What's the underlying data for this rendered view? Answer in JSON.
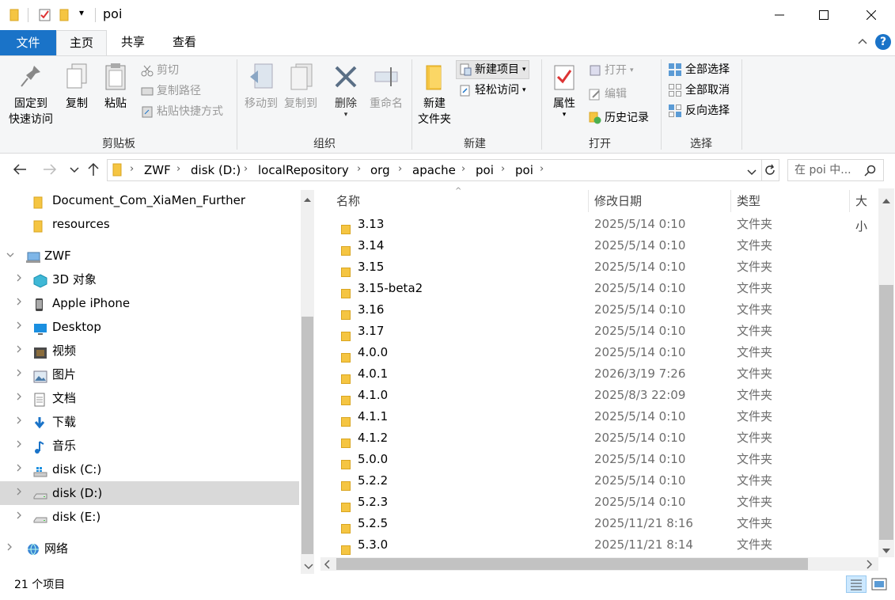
{
  "window": {
    "title": "poi",
    "qa_dropdown": "▾",
    "minimize": "—",
    "maximize": "☐",
    "close": "✕"
  },
  "tabs": [
    {
      "label": "文件"
    },
    {
      "label": "主页"
    },
    {
      "label": "共享"
    },
    {
      "label": "查看"
    }
  ],
  "ribbon": {
    "pin_line1": "固定到",
    "pin_line2": "快速访问",
    "copy": "复制",
    "paste": "粘贴",
    "cut": "剪切",
    "copy_path": "复制路径",
    "paste_shortcut": "粘贴快捷方式",
    "group_clipboard": "剪贴板",
    "move_to": "移动到",
    "copy_to": "复制到",
    "delete": "删除",
    "rename": "重命名",
    "group_organize": "组织",
    "new_folder_line1": "新建",
    "new_folder_line2": "文件夹",
    "new_item": "新建项目",
    "easy_access": "轻松访问",
    "group_new": "新建",
    "properties": "属性",
    "open": "打开",
    "edit": "编辑",
    "history": "历史记录",
    "group_open": "打开",
    "select_all": "全部选择",
    "select_none": "全部取消",
    "invert_selection": "反向选择",
    "group_select": "选择"
  },
  "address": {
    "crumbs": [
      "ZWF",
      "disk (D:)",
      "localRepository",
      "org",
      "apache",
      "poi",
      "poi"
    ],
    "search_placeholder": "在 poi 中..."
  },
  "nav": {
    "items": [
      {
        "label": "Document_Com_XiaMen_Further",
        "icon": "folder-icon",
        "indent": 1,
        "arrow": ""
      },
      {
        "label": "resources",
        "icon": "folder-icon",
        "indent": 1,
        "arrow": ""
      },
      {
        "label": "ZWF",
        "icon": "computer-icon",
        "indent": 0,
        "arrow": "v"
      },
      {
        "label": "3D 对象",
        "icon": "3d-objects-icon",
        "indent": 1,
        "arrow": ">"
      },
      {
        "label": "Apple iPhone",
        "icon": "phone-icon",
        "indent": 1,
        "arrow": ">"
      },
      {
        "label": "Desktop",
        "icon": "desktop-icon",
        "indent": 1,
        "arrow": ">"
      },
      {
        "label": "视频",
        "icon": "video-icon",
        "indent": 1,
        "arrow": ">"
      },
      {
        "label": "图片",
        "icon": "pictures-icon",
        "indent": 1,
        "arrow": ">"
      },
      {
        "label": "文档",
        "icon": "documents-icon",
        "indent": 1,
        "arrow": ">"
      },
      {
        "label": "下载",
        "icon": "downloads-icon",
        "indent": 1,
        "arrow": ">"
      },
      {
        "label": "音乐",
        "icon": "music-icon",
        "indent": 1,
        "arrow": ">"
      },
      {
        "label": "disk (C:)",
        "icon": "drive-c-icon",
        "indent": 1,
        "arrow": ">"
      },
      {
        "label": "disk (D:)",
        "icon": "drive-icon",
        "indent": 1,
        "arrow": ">",
        "selected": true
      },
      {
        "label": "disk (E:)",
        "icon": "drive-icon",
        "indent": 1,
        "arrow": ">"
      },
      {
        "label": "网络",
        "icon": "network-icon",
        "indent": 0,
        "arrow": ">"
      }
    ]
  },
  "columns": {
    "name": "名称",
    "date": "修改日期",
    "type": "类型",
    "size": "大小"
  },
  "files": [
    {
      "name": "3.13",
      "date": "2025/5/14 0:10",
      "type": "文件夹"
    },
    {
      "name": "3.14",
      "date": "2025/5/14 0:10",
      "type": "文件夹"
    },
    {
      "name": "3.15",
      "date": "2025/5/14 0:10",
      "type": "文件夹"
    },
    {
      "name": "3.15-beta2",
      "date": "2025/5/14 0:10",
      "type": "文件夹"
    },
    {
      "name": "3.16",
      "date": "2025/5/14 0:10",
      "type": "文件夹"
    },
    {
      "name": "3.17",
      "date": "2025/5/14 0:10",
      "type": "文件夹"
    },
    {
      "name": "4.0.0",
      "date": "2025/5/14 0:10",
      "type": "文件夹"
    },
    {
      "name": "4.0.1",
      "date": "2026/3/19 7:26",
      "type": "文件夹"
    },
    {
      "name": "4.1.0",
      "date": "2025/8/3 22:09",
      "type": "文件夹"
    },
    {
      "name": "4.1.1",
      "date": "2025/5/14 0:10",
      "type": "文件夹"
    },
    {
      "name": "4.1.2",
      "date": "2025/5/14 0:10",
      "type": "文件夹"
    },
    {
      "name": "5.0.0",
      "date": "2025/5/14 0:10",
      "type": "文件夹"
    },
    {
      "name": "5.2.2",
      "date": "2025/5/14 0:10",
      "type": "文件夹"
    },
    {
      "name": "5.2.3",
      "date": "2025/5/14 0:10",
      "type": "文件夹"
    },
    {
      "name": "5.2.5",
      "date": "2025/11/21 8:16",
      "type": "文件夹"
    },
    {
      "name": "5.3.0",
      "date": "2025/11/21 8:14",
      "type": "文件夹"
    }
  ],
  "status": {
    "count": "21 个项目"
  },
  "colors": {
    "file_tab": "#1a73c8",
    "accent": "#1a73c8",
    "folder": "#f5c542",
    "selected_nav": "#d9d9d9"
  }
}
